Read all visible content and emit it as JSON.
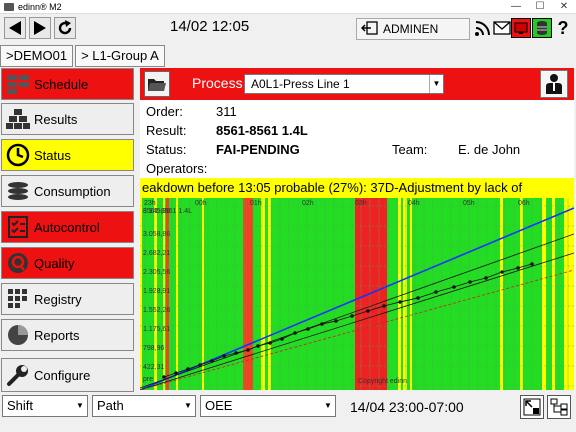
{
  "window": {
    "title": "edinn® M2",
    "minimize": "—",
    "maximize": "☐",
    "close": "✕"
  },
  "toolbar": {
    "clock": "14/02 12:05",
    "user": "ADMINEN"
  },
  "breadcrumb": [
    ">DEMO01",
    "> L1-Group A"
  ],
  "sidebar": {
    "items": [
      {
        "label": "Schedule",
        "state": "red"
      },
      {
        "label": "Results",
        "state": "normal"
      },
      {
        "label": "Status",
        "state": "yellow"
      },
      {
        "label": "Consumption",
        "state": "normal"
      },
      {
        "label": "Autocontrol",
        "state": "red"
      },
      {
        "label": "Quality",
        "state": "red"
      },
      {
        "label": "Registry",
        "state": "normal"
      },
      {
        "label": "Reports",
        "state": "normal"
      },
      {
        "label": "Configure",
        "state": "normal"
      }
    ]
  },
  "process": {
    "label": "Process",
    "value": "A0L1-Press Line 1"
  },
  "info": {
    "order_label": "Order:",
    "order": "311",
    "result_label": "Result:",
    "result": "8561-8561 1.4L",
    "status_label": "Status:",
    "status": "FAI-PENDING",
    "team_label": "Team:",
    "team": "E. de John",
    "operators_label": "Operators:"
  },
  "ticker": "eakdown before 13:05 probable (27%): 37D-Adjustment by lack of",
  "chart_data": {
    "type": "line",
    "x_ticks": [
      "23h",
      "00h",
      "01h",
      "02h",
      "03h",
      "04h",
      "05h",
      "06h"
    ],
    "y_ticks": [
      "3.145,36",
      "3.058,86",
      "2.682,21",
      "2.305,56",
      "1.928,91",
      "1.552,26",
      "1.175,61",
      "798,96",
      "422,31"
    ],
    "series_label": "8561-8561 1.4L",
    "footer": "Copyright edinn",
    "pre_label": "pre"
  },
  "bottom": {
    "selects": [
      "Shift",
      "Path",
      "OEE"
    ],
    "range": "14/04 23:00-07:00"
  }
}
